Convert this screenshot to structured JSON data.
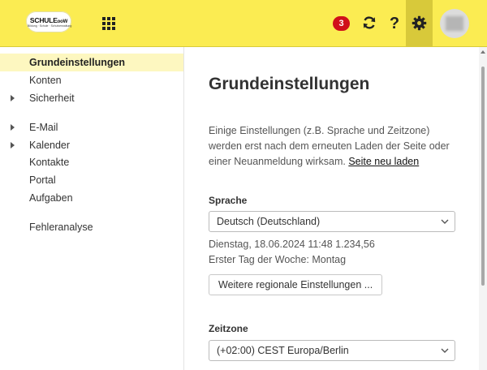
{
  "header": {
    "logo_main": "SCHULE",
    "logo_sup": "ooW",
    "logo_sub": "Bildung · Schule · Schulverwaltung",
    "notification_count": "3",
    "help_label": "?",
    "colors": {
      "bar": "#fbec52",
      "active": "#d8c93a",
      "badge": "#d0101a"
    }
  },
  "sidebar": {
    "items": [
      {
        "label": "Grundeinstellungen"
      },
      {
        "label": "Konten"
      },
      {
        "label": "Sicherheit"
      },
      {
        "label": "E-Mail"
      },
      {
        "label": "Kalender"
      },
      {
        "label": "Kontakte"
      },
      {
        "label": "Portal"
      },
      {
        "label": "Aufgaben"
      },
      {
        "label": "Fehleranalyse"
      }
    ]
  },
  "main": {
    "title": "Grundeinstellungen",
    "description": "Einige Einstellungen (z.B. Sprache und Zeitzone) werden erst nach dem erneuten Laden der Seite oder einer Neuanmeldung wirksam.",
    "reload_link": "Seite neu laden",
    "language_label": "Sprache",
    "language_value": "Deutsch (Deutschland)",
    "date_preview": "Dienstag, 18.06.2024 11:48   1.234,56",
    "first_day": "Erster Tag der Woche: Montag",
    "regional_button": "Weitere regionale Einstellungen ...",
    "timezone_label": "Zeitzone",
    "timezone_value": "(+02:00) CEST Europa/Berlin"
  }
}
